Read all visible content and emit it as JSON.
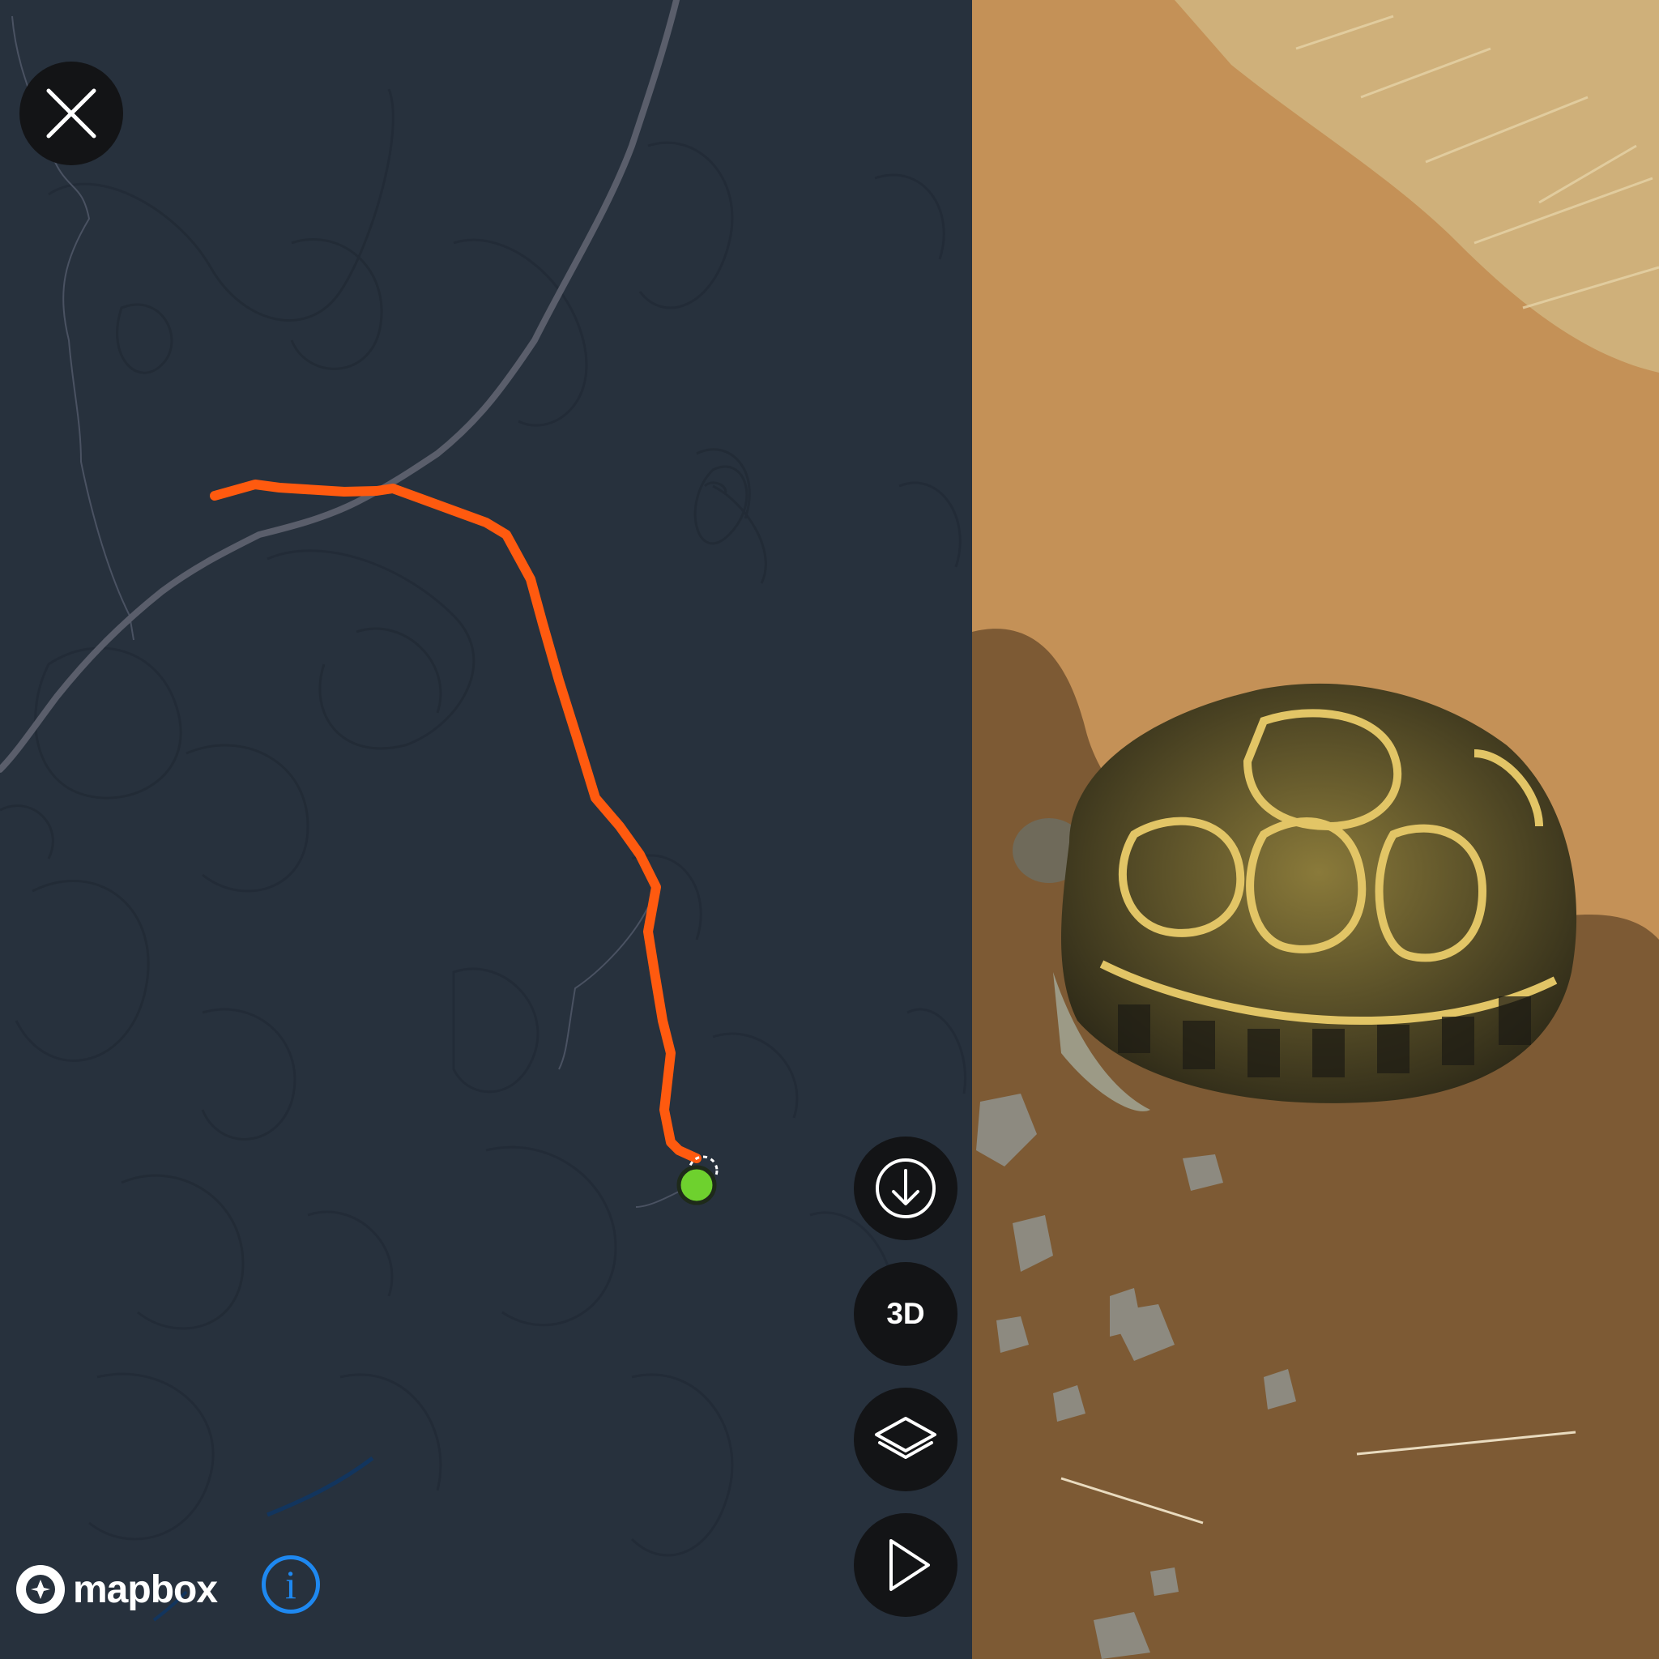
{
  "map": {
    "route_color": "#ff5a0f",
    "road_color": "#5a5e6b",
    "background_color": "#27313d",
    "end_marker_color": "#6ed12e",
    "attribution": {
      "logo_text": "mapbox",
      "logo_icon": "mapbox-compass-icon",
      "info_icon": "info-icon",
      "info_color": "#1e88f0"
    }
  },
  "controls": {
    "close": {
      "icon": "close-icon"
    },
    "download": {
      "icon": "download-icon"
    },
    "view_3d": {
      "label": "3D"
    },
    "layers": {
      "icon": "layers-icon"
    },
    "play": {
      "icon": "play-icon"
    }
  },
  "photo": {
    "subject": "tortoise-photo"
  }
}
